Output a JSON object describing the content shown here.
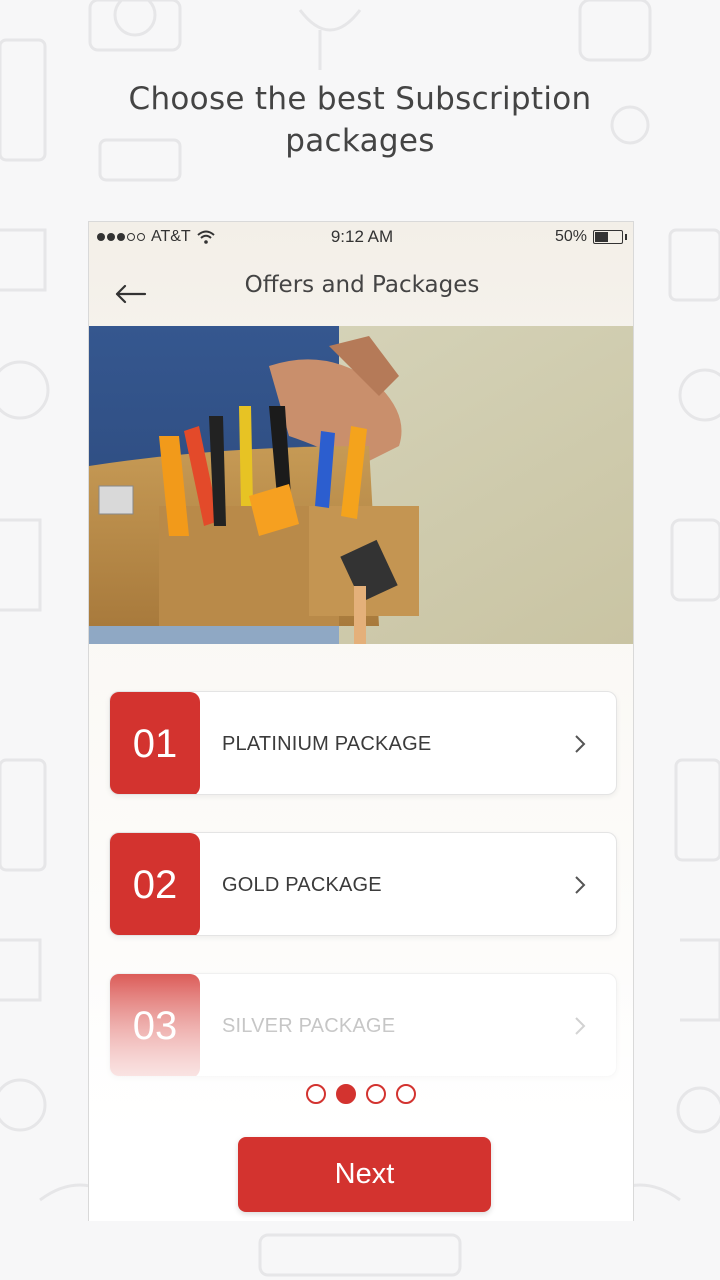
{
  "headline": {
    "line1": "Choose the best Subscription",
    "line2": "packages"
  },
  "status_bar": {
    "carrier": "AT&T",
    "signal_bars_filled": 3,
    "signal_bars_total": 5,
    "time": "9:12 AM",
    "battery": "50%",
    "battery_level": 0.5
  },
  "nav": {
    "back_icon": "arrow-left-icon",
    "title": "Offers and Packages"
  },
  "hero": {
    "icon": "tool-belt-photo"
  },
  "packages": [
    {
      "number": "01",
      "label": "PLATINIUM PACKAGE",
      "icon": "chevron-right-icon"
    },
    {
      "number": "02",
      "label": "GOLD PACKAGE",
      "icon": "chevron-right-icon"
    },
    {
      "number": "03",
      "label": "SILVER PACKAGE",
      "icon": "chevron-right-icon"
    }
  ],
  "pager": {
    "count": 4,
    "active_index": 1
  },
  "next_button": {
    "label": "Next"
  },
  "colors": {
    "accent": "#d3332f",
    "text": "#444444",
    "background": "#f7f7f8"
  }
}
